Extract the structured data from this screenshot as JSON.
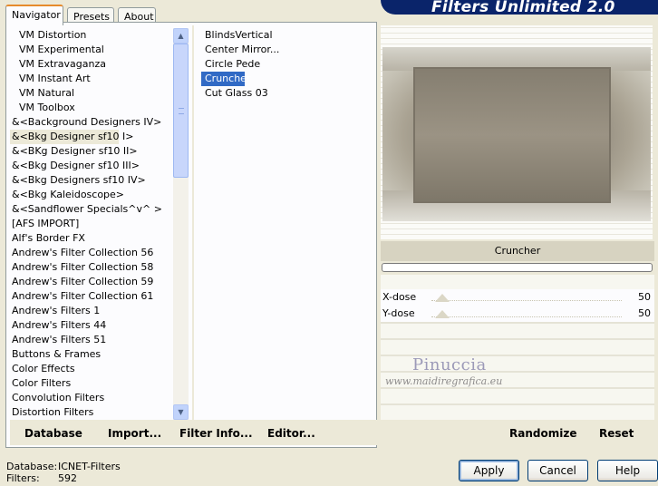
{
  "tabs": [
    "Navigator",
    "Presets",
    "About"
  ],
  "header_title": "Filters Unlimited 2.0",
  "categories": [
    "VM Distortion",
    "VM Experimental",
    "VM Extravaganza",
    "VM Instant Art",
    "VM Natural",
    "VM Toolbox",
    "&<Background Designers IV>",
    "&<Bkg Designer sf10 I>",
    "&<BKg Designer sf10 II>",
    "&<Bkg Designer sf10 III>",
    "&<Bkg Designers sf10 IV>",
    "&<Bkg Kaleidoscope>",
    "&<Sandflower Specials^v^ >",
    "[AFS IMPORT]",
    "Alf's Border FX",
    "Andrew's Filter Collection 56",
    "Andrew's Filter Collection 58",
    "Andrew's Filter Collection 59",
    "Andrew's Filter Collection 61",
    "Andrew's Filters 1",
    "Andrew's Filters 44",
    "Andrew's Filters 51",
    "Buttons & Frames",
    "Color Effects",
    "Color Filters",
    "Convolution Filters",
    "Distortion Filters"
  ],
  "selected_category": "&<Bkg Designer sf10 I>",
  "filters": [
    "BlindsVertical",
    "Center Mirror...",
    "Circle Pede",
    "Cruncher",
    "Cut Glass 03"
  ],
  "selected_filter": "Cruncher",
  "links": {
    "database": "Database",
    "import": "Import...",
    "filter_info": "Filter Info...",
    "editor": "Editor..."
  },
  "preview": {
    "filter_name": "Cruncher"
  },
  "params": [
    {
      "label": "X-dose",
      "value": "50"
    },
    {
      "label": "Y-dose",
      "value": "50"
    }
  ],
  "watermark": {
    "name": "Pinuccia",
    "url": "www.maidiregrafica.eu"
  },
  "actions": {
    "randomize": "Randomize",
    "reset": "Reset"
  },
  "status": {
    "database_label": "Database:",
    "database_value": "ICNET-Filters",
    "filters_label": "Filters:",
    "filters_value": "592"
  },
  "buttons": {
    "apply": "Apply",
    "cancel": "Cancel",
    "help": "Help"
  },
  "colors": {
    "selection": "#316ac5",
    "header": "#0a246a",
    "tab_highlight": "#e68b2c"
  }
}
